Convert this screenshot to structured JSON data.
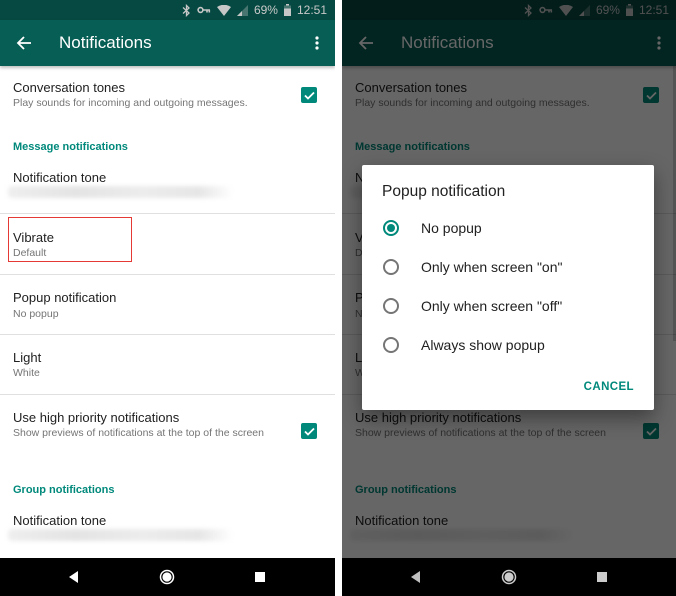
{
  "status_bar": {
    "icons": [
      "bluetooth-icon",
      "vpn-key-icon",
      "wifi-icon",
      "cell-signal-icon",
      "battery-icon"
    ],
    "battery": "69%",
    "time": "12:51"
  },
  "app_bar": {
    "back_icon": "arrow-back-icon",
    "title": "Notifications",
    "menu_icon": "more-vert-icon"
  },
  "settings": {
    "conversation_tones": {
      "title": "Conversation tones",
      "summary": "Play sounds for incoming and outgoing messages.",
      "checked": true
    },
    "message_category": "Message notifications",
    "message": {
      "notification_tone": {
        "title": "Notification tone",
        "summary_blurred": true
      },
      "vibrate": {
        "title": "Vibrate",
        "summary": "Default"
      },
      "popup": {
        "title": "Popup notification",
        "summary": "No popup"
      },
      "light": {
        "title": "Light",
        "summary": "White"
      },
      "high_priority": {
        "title": "Use high priority notifications",
        "summary": "Show previews of notifications at the top of the screen",
        "checked": true
      }
    },
    "group_category": "Group notifications",
    "group": {
      "notification_tone": {
        "title": "Notification tone",
        "summary_blurred": true
      }
    }
  },
  "dialog": {
    "title": "Popup notification",
    "options": [
      {
        "label": "No popup",
        "selected": true
      },
      {
        "label": "Only when screen \"on\"",
        "selected": false
      },
      {
        "label": "Only when screen \"off\"",
        "selected": false
      },
      {
        "label": "Always show popup",
        "selected": false
      }
    ],
    "cancel_label": "CANCEL"
  },
  "nav_bar": {
    "icons": [
      "nav-back-icon",
      "nav-home-icon",
      "nav-recents-icon"
    ]
  },
  "colors": {
    "primary": "#075e54",
    "accent": "#00897b",
    "highlight_box": "#e53935"
  }
}
